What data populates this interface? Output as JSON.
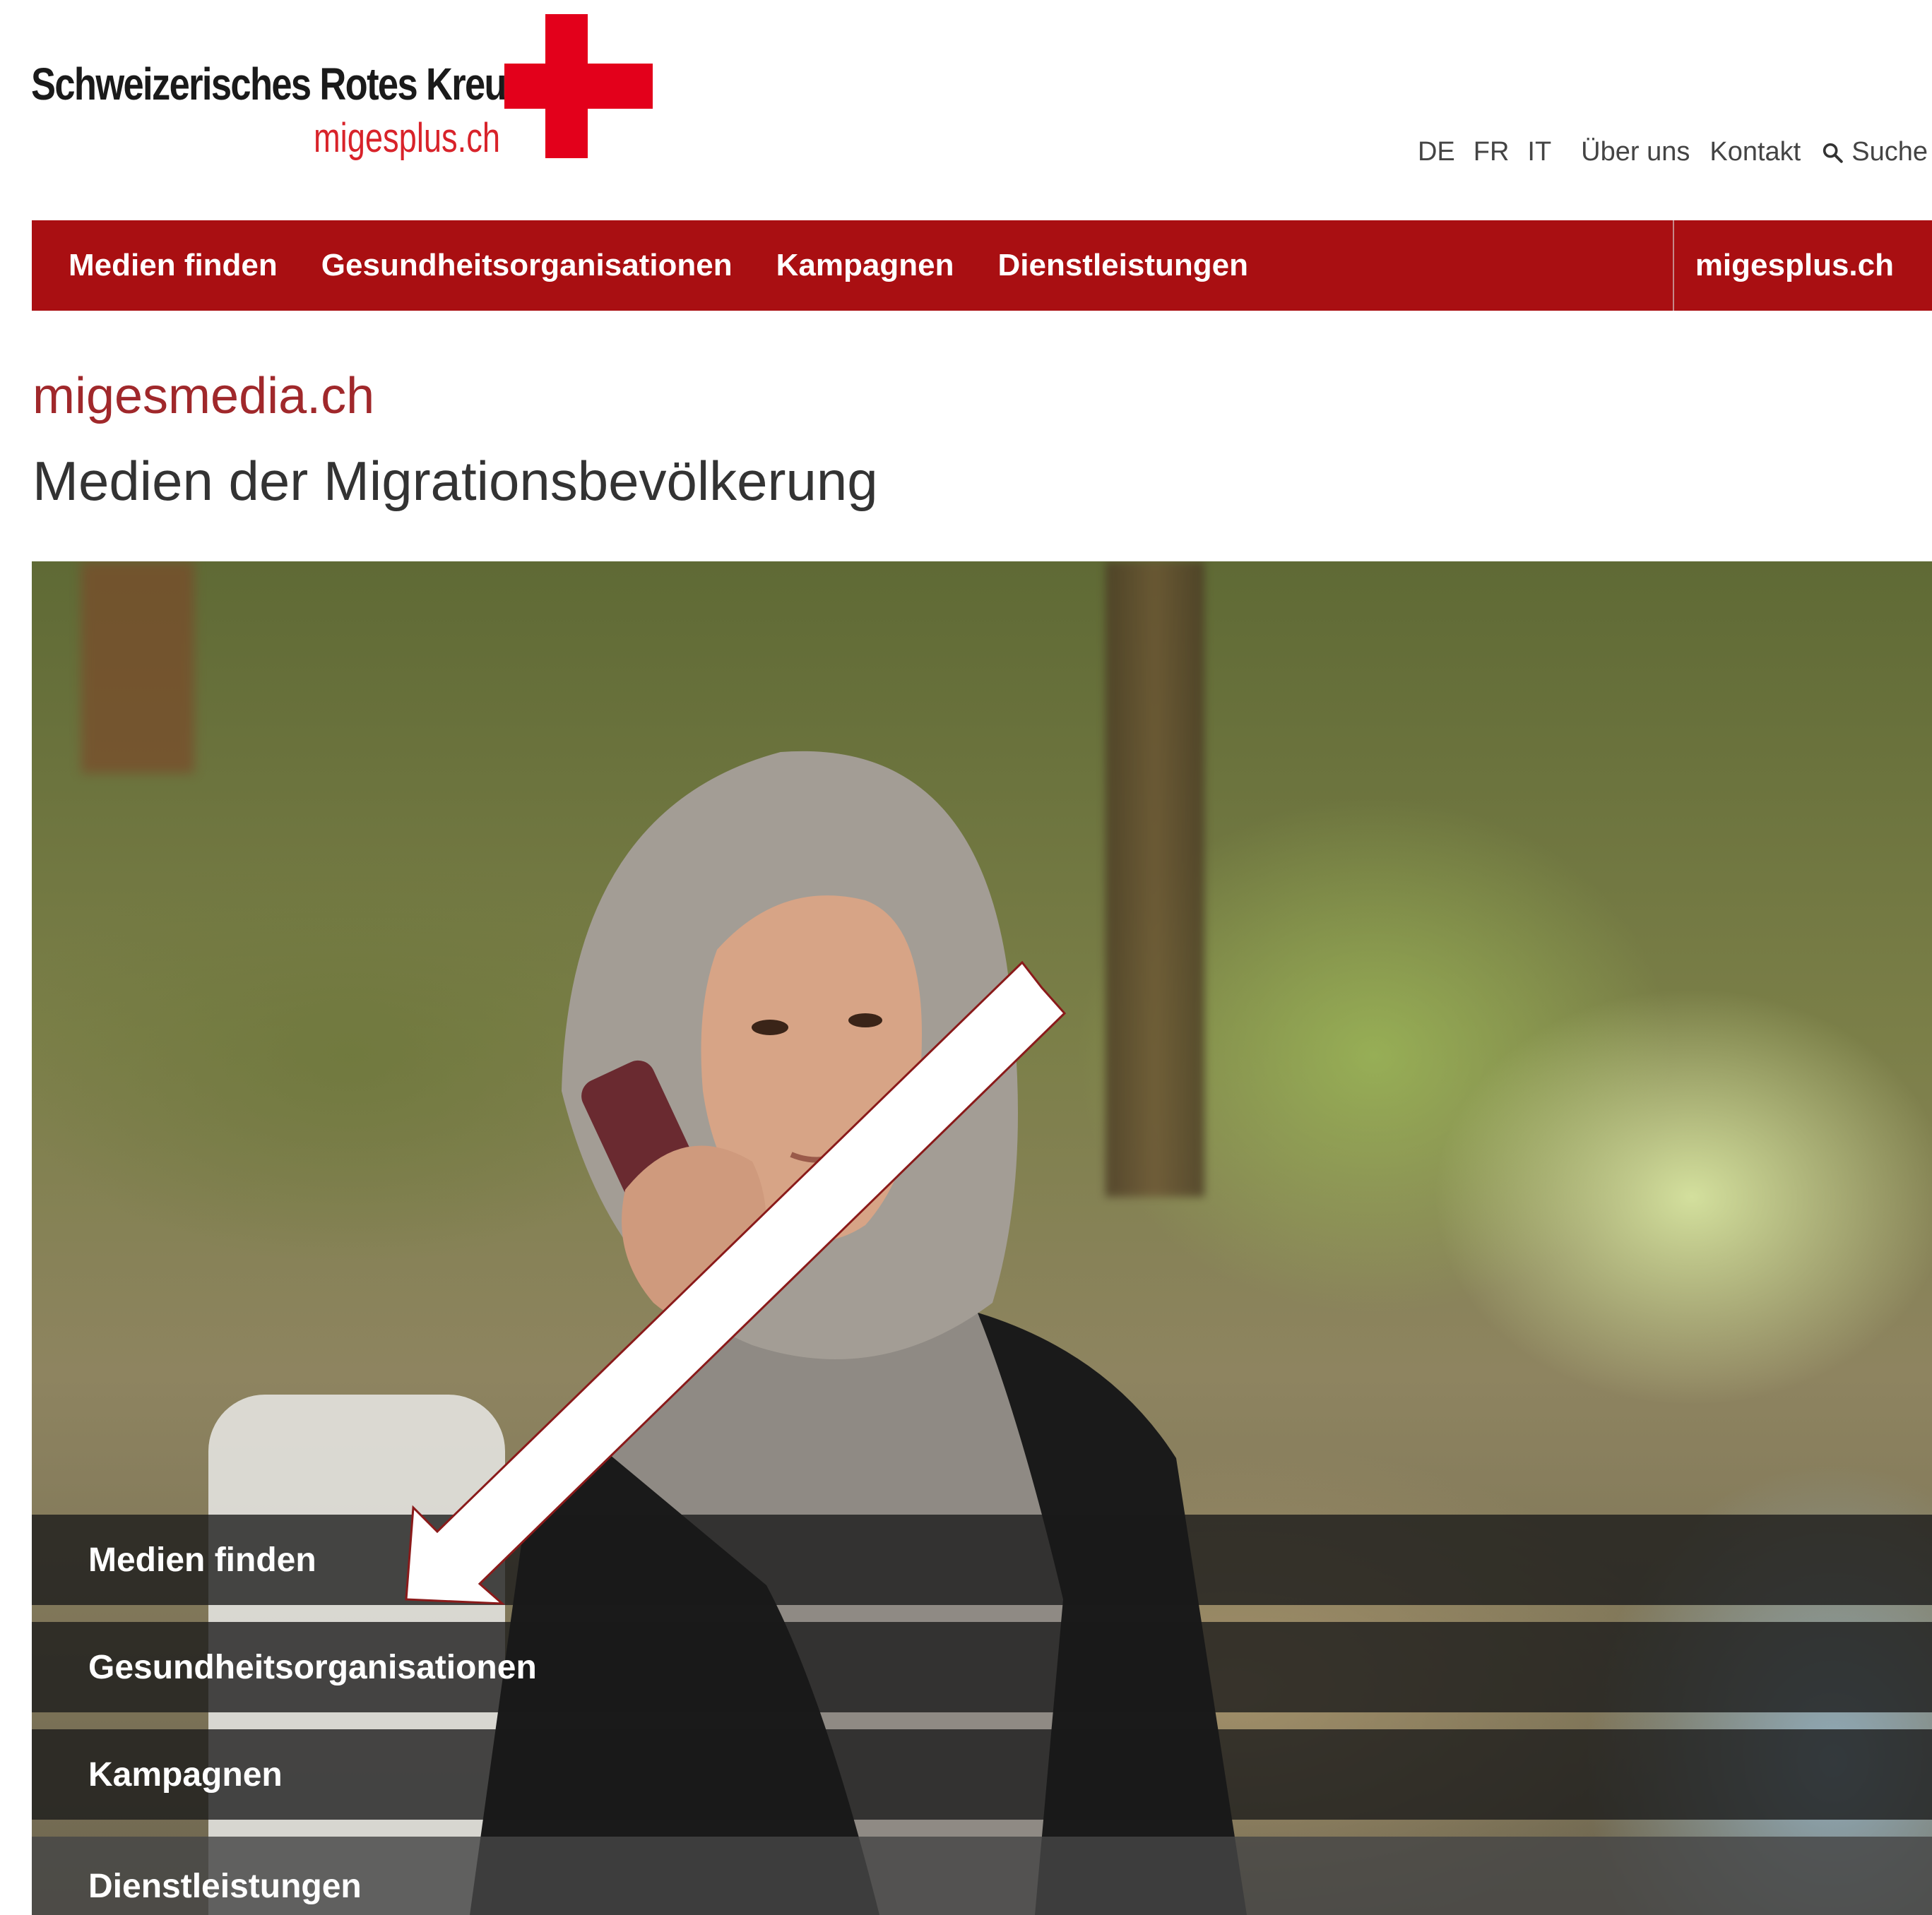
{
  "logo": {
    "org_name": "Schweizerisches Rotes Kreuz",
    "sub_name": "migesplus.ch"
  },
  "meta_nav": {
    "languages": [
      "DE",
      "FR",
      "IT"
    ],
    "about": "Über uns",
    "contact": "Kontakt",
    "search": "Suche"
  },
  "main_nav": {
    "items": [
      "Medien finden",
      "Gesundheitsorganisationen",
      "Kampagnen",
      "Dienstleistungen"
    ],
    "brand_link": "migesplus.ch"
  },
  "site_title": "migesmedia.ch",
  "page_title": "Medien der Migrationsbevölkerung",
  "hero_menu": {
    "items": [
      "Medien finden",
      "Gesundheitsorganisationen",
      "Kampagnen",
      "Dienstleistungen"
    ]
  },
  "colors": {
    "brand_red": "#e3001b",
    "nav_red": "#a90f12",
    "title_red": "#a0282b"
  }
}
